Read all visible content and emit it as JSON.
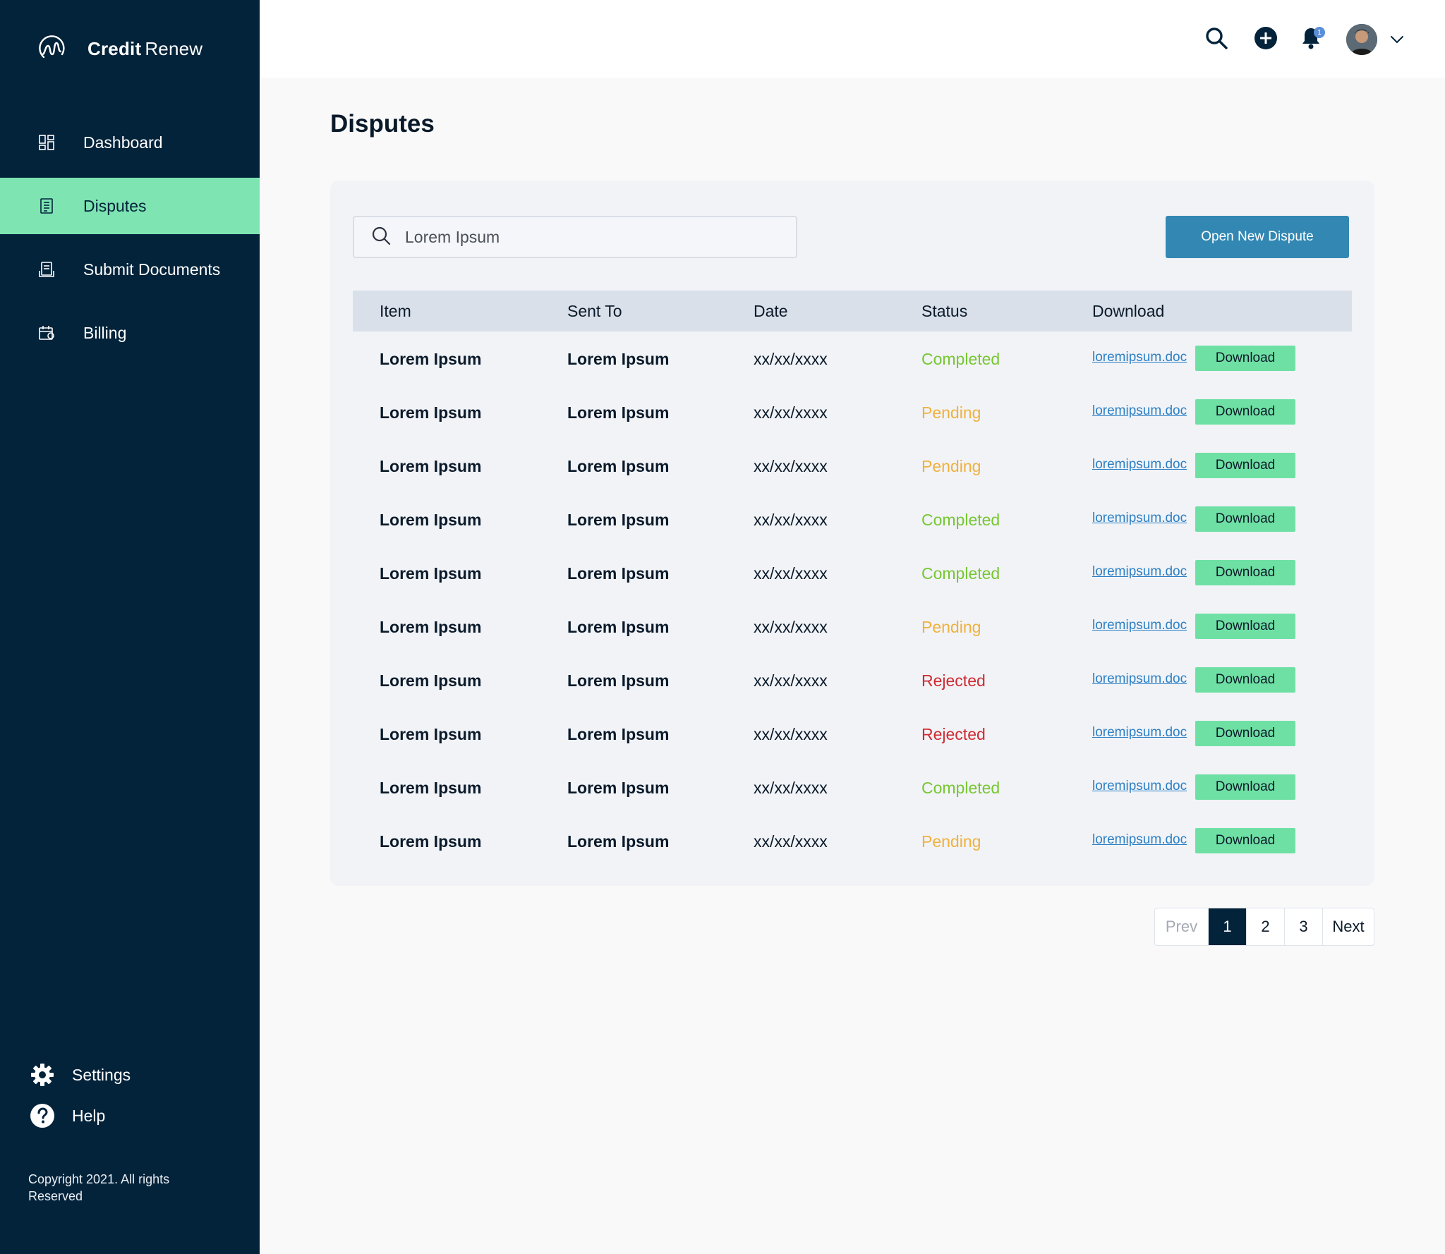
{
  "brand": {
    "name_bold": "Credit",
    "name_light": "Renew"
  },
  "sidebar": {
    "items": [
      {
        "label": "Dashboard",
        "icon": "dashboard-icon",
        "active": false
      },
      {
        "label": "Disputes",
        "icon": "document-icon",
        "active": true
      },
      {
        "label": "Submit Documents",
        "icon": "submit-documents-icon",
        "active": false
      },
      {
        "label": "Billing",
        "icon": "billing-icon",
        "active": false
      }
    ],
    "footer": [
      {
        "label": "Settings",
        "icon": "gear-icon"
      },
      {
        "label": "Help",
        "icon": "help-icon"
      }
    ],
    "copyright": "Copyright 2021. All rights Reserved"
  },
  "topbar": {
    "notification_count": "1"
  },
  "main": {
    "title": "Disputes",
    "search": {
      "placeholder": "Lorem Ipsum"
    },
    "open_button": "Open New Dispute",
    "columns": [
      "Item",
      "Sent To",
      "Date",
      "Status",
      "Download"
    ],
    "rows": [
      {
        "item": "Lorem Ipsum",
        "sent_to": "Lorem Ipsum",
        "date": "xx/xx/xxxx",
        "status": "Completed",
        "file": "loremipsum.doc",
        "button": "Download"
      },
      {
        "item": "Lorem Ipsum",
        "sent_to": "Lorem Ipsum",
        "date": "xx/xx/xxxx",
        "status": "Pending",
        "file": "loremipsum.doc",
        "button": "Download"
      },
      {
        "item": "Lorem Ipsum",
        "sent_to": "Lorem Ipsum",
        "date": "xx/xx/xxxx",
        "status": "Pending",
        "file": "loremipsum.doc",
        "button": "Download"
      },
      {
        "item": "Lorem Ipsum",
        "sent_to": "Lorem Ipsum",
        "date": "xx/xx/xxxx",
        "status": "Completed",
        "file": "loremipsum.doc",
        "button": "Download"
      },
      {
        "item": "Lorem Ipsum",
        "sent_to": "Lorem Ipsum",
        "date": "xx/xx/xxxx",
        "status": "Completed",
        "file": "loremipsum.doc",
        "button": "Download"
      },
      {
        "item": "Lorem Ipsum",
        "sent_to": "Lorem Ipsum",
        "date": "xx/xx/xxxx",
        "status": "Pending",
        "file": "loremipsum.doc",
        "button": "Download"
      },
      {
        "item": "Lorem Ipsum",
        "sent_to": "Lorem Ipsum",
        "date": "xx/xx/xxxx",
        "status": "Rejected",
        "file": "loremipsum.doc",
        "button": "Download"
      },
      {
        "item": "Lorem Ipsum",
        "sent_to": "Lorem Ipsum",
        "date": "xx/xx/xxxx",
        "status": "Rejected",
        "file": "loremipsum.doc",
        "button": "Download"
      },
      {
        "item": "Lorem Ipsum",
        "sent_to": "Lorem Ipsum",
        "date": "xx/xx/xxxx",
        "status": "Completed",
        "file": "loremipsum.doc",
        "button": "Download"
      },
      {
        "item": "Lorem Ipsum",
        "sent_to": "Lorem Ipsum",
        "date": "xx/xx/xxxx",
        "status": "Pending",
        "file": "loremipsum.doc",
        "button": "Download"
      }
    ]
  },
  "pagination": {
    "prev": "Prev",
    "pages": [
      "1",
      "2",
      "3"
    ],
    "current": "1",
    "next": "Next"
  },
  "colors": {
    "sidebar_bg": "#03233a",
    "active_nav": "#7de4b2",
    "primary_button": "#3288b3",
    "download_button": "#6fe0a4",
    "completed": "#77c631",
    "pending": "#f0b13d",
    "rejected": "#d02a31",
    "link": "#2b7fc4"
  }
}
